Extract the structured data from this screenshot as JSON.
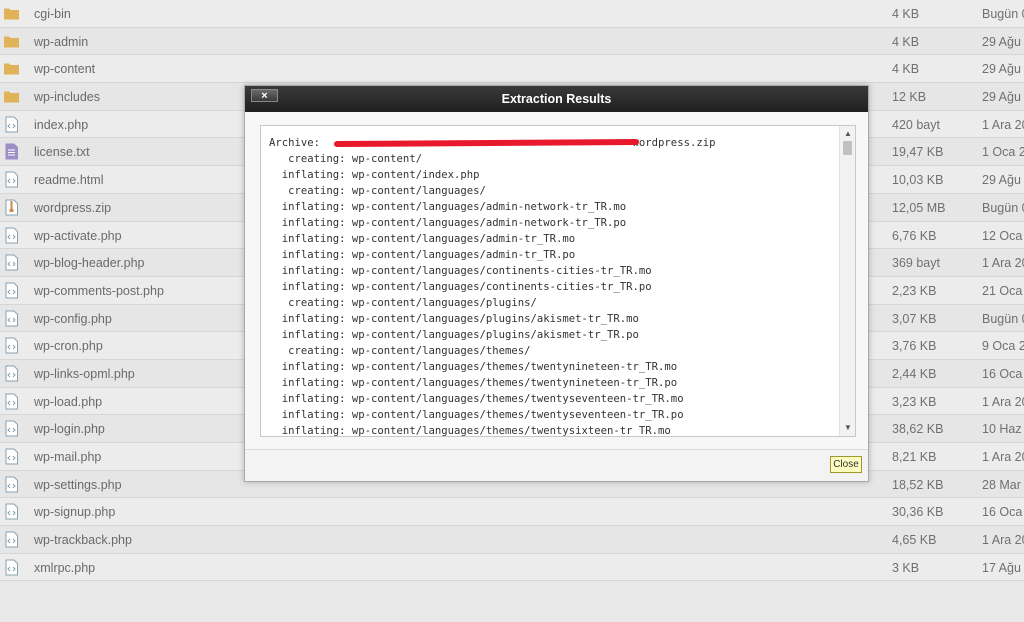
{
  "files": [
    {
      "name": "cgi-bin",
      "size": "4 KB",
      "date": "Bugün 0",
      "icon": "folder-icon"
    },
    {
      "name": "wp-admin",
      "size": "4 KB",
      "date": "29 Ağu",
      "icon": "folder-icon"
    },
    {
      "name": "wp-content",
      "size": "4 KB",
      "date": "29 Ağu",
      "icon": "folder-icon"
    },
    {
      "name": "wp-includes",
      "size": "12 KB",
      "date": "29 Ağu",
      "icon": "folder-icon"
    },
    {
      "name": "index.php",
      "size": "420 bayt",
      "date": "1 Ara 20",
      "icon": "php-file-icon"
    },
    {
      "name": "license.txt",
      "size": "19,47 KB",
      "date": "1 Oca 2",
      "icon": "text-file-icon"
    },
    {
      "name": "readme.html",
      "size": "10,03 KB",
      "date": "29 Ağu",
      "icon": "code-file-icon"
    },
    {
      "name": "wordpress.zip",
      "size": "12,05 MB",
      "date": "Bugün 0",
      "icon": "zip-file-icon"
    },
    {
      "name": "wp-activate.php",
      "size": "6,76 KB",
      "date": "12 Oca",
      "icon": "php-file-icon"
    },
    {
      "name": "wp-blog-header.php",
      "size": "369 bayt",
      "date": "1 Ara 20",
      "icon": "php-file-icon"
    },
    {
      "name": "wp-comments-post.php",
      "size": "2,23 KB",
      "date": "21 Oca",
      "icon": "php-file-icon"
    },
    {
      "name": "wp-config.php",
      "size": "3,07 KB",
      "date": "Bugün 0",
      "icon": "php-file-icon"
    },
    {
      "name": "wp-cron.php",
      "size": "3,76 KB",
      "date": "9 Oca 2",
      "icon": "php-file-icon"
    },
    {
      "name": "wp-links-opml.php",
      "size": "2,44 KB",
      "date": "16 Oca",
      "icon": "php-file-icon"
    },
    {
      "name": "wp-load.php",
      "size": "3,23 KB",
      "date": "1 Ara 20",
      "icon": "php-file-icon"
    },
    {
      "name": "wp-login.php",
      "size": "38,62 KB",
      "date": "10 Haz",
      "icon": "php-file-icon"
    },
    {
      "name": "wp-mail.php",
      "size": "8,21 KB",
      "date": "1 Ara 20",
      "icon": "php-file-icon"
    },
    {
      "name": "wp-settings.php",
      "size": "18,52 KB",
      "date": "28 Mar",
      "icon": "php-file-icon"
    },
    {
      "name": "wp-signup.php",
      "size": "30,36 KB",
      "date": "16 Oca",
      "icon": "php-file-icon"
    },
    {
      "name": "wp-trackback.php",
      "size": "4,65 KB",
      "date": "1 Ara 20",
      "icon": "php-file-icon"
    },
    {
      "name": "xmlrpc.php",
      "size": "3 KB",
      "date": "17 Ağu",
      "icon": "php-file-icon"
    }
  ],
  "dialog": {
    "title": "Extraction Results",
    "close_x": "×",
    "close_button": "Close",
    "output_lines": [
      "Archive:                                                 wordpress.zip",
      "   creating: wp-content/",
      "  inflating: wp-content/index.php",
      "   creating: wp-content/languages/",
      "  inflating: wp-content/languages/admin-network-tr_TR.mo",
      "  inflating: wp-content/languages/admin-network-tr_TR.po",
      "  inflating: wp-content/languages/admin-tr_TR.mo",
      "  inflating: wp-content/languages/admin-tr_TR.po",
      "  inflating: wp-content/languages/continents-cities-tr_TR.mo",
      "  inflating: wp-content/languages/continents-cities-tr_TR.po",
      "   creating: wp-content/languages/plugins/",
      "  inflating: wp-content/languages/plugins/akismet-tr_TR.mo",
      "  inflating: wp-content/languages/plugins/akismet-tr_TR.po",
      "   creating: wp-content/languages/themes/",
      "  inflating: wp-content/languages/themes/twentynineteen-tr_TR.mo",
      "  inflating: wp-content/languages/themes/twentynineteen-tr_TR.po",
      "  inflating: wp-content/languages/themes/twentyseventeen-tr_TR.mo",
      "  inflating: wp-content/languages/themes/twentyseventeen-tr_TR.po",
      "  inflating: wp-content/languages/themes/twentysixteen-tr_TR.mo"
    ]
  },
  "colors": {
    "folder": "#e0b25a",
    "file_outline": "#8aa0b0",
    "text_file": "#9b8fc6",
    "zip_file": "#c98a4a",
    "redaction": "#e8192c",
    "close_button_bg": "#fffcc0"
  }
}
